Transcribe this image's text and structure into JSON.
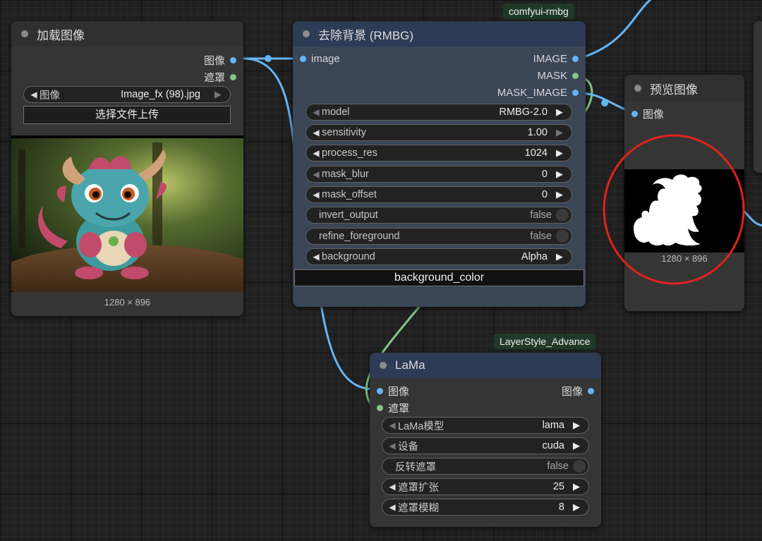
{
  "badges": {
    "rmbg": "comfyui-rmbg",
    "lama": "LayerStyle_Advance"
  },
  "load_node": {
    "title": "加载图像",
    "outputs": [
      "图像",
      "遮罩"
    ],
    "image_widget": {
      "name": "图像",
      "value": "Image_fx (98).jpg"
    },
    "upload_button": "选择文件上传",
    "size": "1280 × 896"
  },
  "rmbg_node": {
    "title": "去除背景 (RMBG)",
    "input": "image",
    "outputs": [
      "IMAGE",
      "MASK",
      "MASK_IMAGE"
    ],
    "widgets": [
      {
        "name": "model",
        "value": "RMBG-2.0"
      },
      {
        "name": "sensitivity",
        "value": "1.00"
      },
      {
        "name": "process_res",
        "value": "1024"
      },
      {
        "name": "mask_blur",
        "value": "0"
      },
      {
        "name": "mask_offset",
        "value": "0"
      },
      {
        "name": "invert_output",
        "value": "false"
      },
      {
        "name": "refine_foreground",
        "value": "false"
      },
      {
        "name": "background",
        "value": "Alpha"
      }
    ],
    "color_button": "background_color"
  },
  "preview_node": {
    "title": "预览图像",
    "input": "图像",
    "size": "1280 × 896"
  },
  "lama_node": {
    "title": "LaMa",
    "inputs": [
      "图像",
      "遮罩"
    ],
    "output": "图像",
    "widgets": [
      {
        "name": "LaMa模型",
        "value": "lama"
      },
      {
        "name": "设备",
        "value": "cuda"
      },
      {
        "name": "反转遮罩",
        "value": "false"
      },
      {
        "name": "遮罩扩张",
        "value": "25"
      },
      {
        "name": "遮罩模糊",
        "value": "8"
      }
    ]
  },
  "colors": {
    "image_link": "#64b5f6",
    "mask_link": "#81c784",
    "highlight_circle": "#e0231b"
  }
}
